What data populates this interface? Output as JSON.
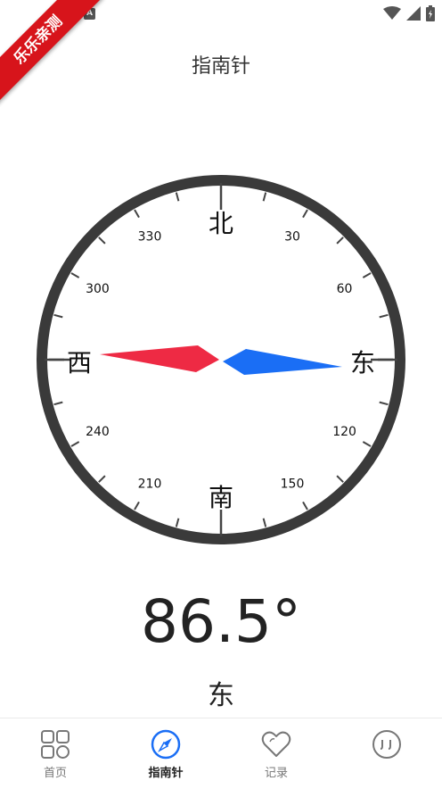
{
  "app": {
    "title": "指南针",
    "watermark": "乐乐亲测"
  },
  "status_bar": {
    "notification_badge": "A",
    "icons": [
      "wifi-icon",
      "signal-icon",
      "battery-icon"
    ]
  },
  "compass": {
    "ring_color": "#3a3a3a",
    "cardinals": {
      "north": "北",
      "south": "南",
      "west": "西",
      "east": "东"
    },
    "degree_labels": [
      "30",
      "60",
      "120",
      "150",
      "210",
      "240",
      "300",
      "330"
    ],
    "needle": {
      "west_color": "#ee2a44",
      "east_color": "#1a6ef5"
    }
  },
  "reading": {
    "degrees": "86.5°",
    "direction": "东"
  },
  "bottom_nav": {
    "accent_color": "#1a6ef5",
    "items": [
      {
        "label": "首页",
        "icon": "grid-icon",
        "active": false
      },
      {
        "label": "指南针",
        "icon": "compass-icon",
        "active": true
      },
      {
        "label": "记录",
        "icon": "heart-icon",
        "active": false
      },
      {
        "label": "",
        "icon": "smiley-icon",
        "active": false
      }
    ]
  }
}
